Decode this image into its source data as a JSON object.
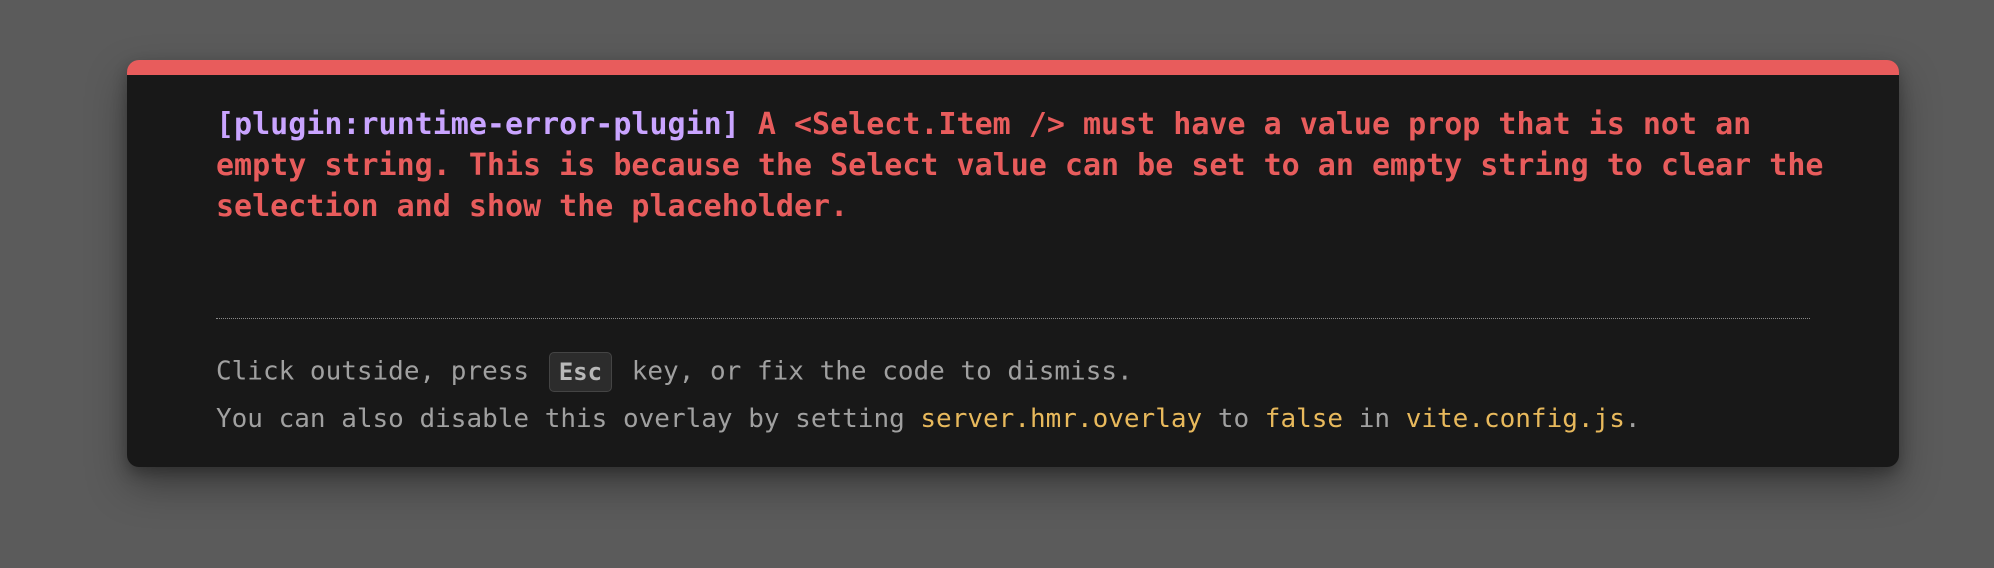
{
  "error": {
    "plugin_tag": "[plugin:runtime-error-plugin]",
    "message": " A <Select.Item /> must have a value prop that is not an empty string. This is because the Select value can be set to an empty string to clear the selection and show the placeholder."
  },
  "tip": {
    "line1_prefix": "Click outside, press ",
    "key": "Esc",
    "line1_suffix": " key, or fix the code to dismiss.",
    "line2_part1": "You can also disable this overlay by setting ",
    "setting": "server.hmr.overlay",
    "line2_part2": " to ",
    "value": "false",
    "line2_part3": " in ",
    "file": "vite.config.js",
    "line2_end": "."
  },
  "colors": {
    "accent_red": "#e85c5c",
    "plugin_purple": "#c9a4ff",
    "code_yellow": "#e8b95c",
    "panel_bg": "#181818",
    "backdrop": "#5b5b5b"
  }
}
